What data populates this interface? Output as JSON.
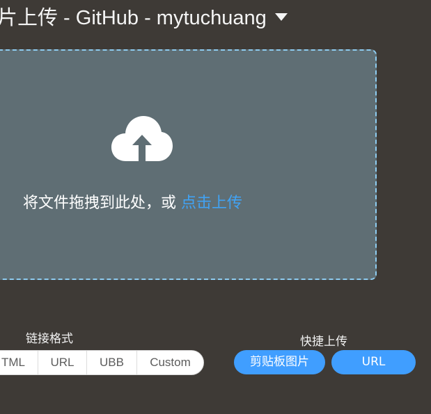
{
  "header": {
    "title": "片上传 - GitHub - mytuchuang",
    "caret_icon": "caret-down-icon"
  },
  "dropzone": {
    "icon": "cloud-upload-icon",
    "text": "将文件拖拽到此处，或 ",
    "link_text": "点击上传"
  },
  "link_format": {
    "label": "链接格式",
    "options": [
      "TML",
      "URL",
      "UBB",
      "Custom"
    ]
  },
  "quick_upload": {
    "label": "快捷上传",
    "clipboard_label": "剪贴板图片",
    "url_label": "URL"
  },
  "colors": {
    "background": "#3e3a36",
    "dropzone": "#5f6e74",
    "dropzone_border": "#8ecdf2",
    "accent": "#409eff",
    "link": "#40a3f5"
  }
}
